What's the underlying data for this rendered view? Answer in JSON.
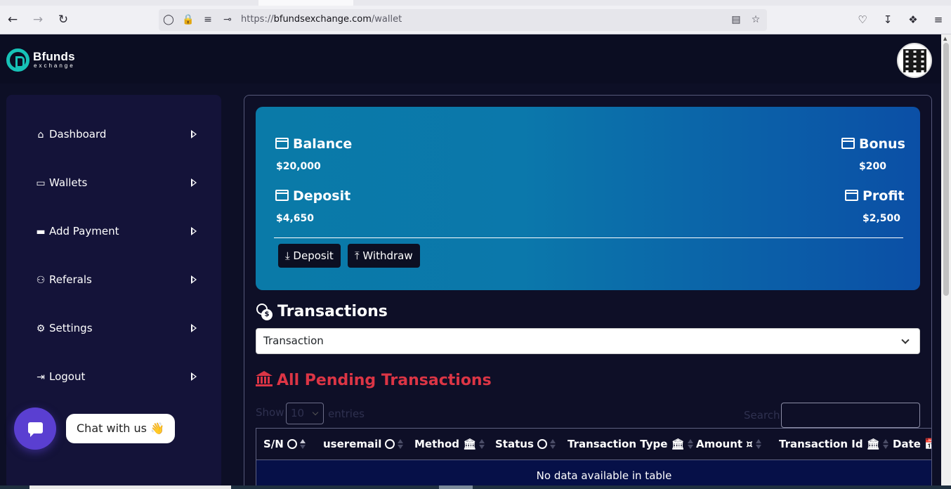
{
  "browser": {
    "url_prefix": "https://",
    "url_host": "bfundsexchange.com",
    "url_path": "/wallet",
    "icons": [
      "back-icon",
      "forward-icon",
      "reload-icon",
      "shield-icon",
      "lock-icon",
      "permissions-icon",
      "key-icon",
      "reader-view-icon",
      "star-icon",
      "pocket-icon",
      "download-icon",
      "extensions-icon",
      "menu-icon"
    ]
  },
  "header": {
    "logo_name": "Bfunds",
    "logo_sub": "exchange",
    "brand_color": "#17c2b7"
  },
  "sidebar": {
    "items": [
      {
        "label": "Dashboard",
        "icon": "home-icon"
      },
      {
        "label": "Wallets",
        "icon": "wallet-icon"
      },
      {
        "label": "Add Payment",
        "icon": "card-icon"
      },
      {
        "label": "Referals",
        "icon": "people-icon"
      },
      {
        "label": "Settings",
        "icon": "user-gear-icon"
      },
      {
        "label": "Logout",
        "icon": "logout-icon"
      }
    ]
  },
  "chat": {
    "label": "Chat with us 👋"
  },
  "wallet": {
    "balance_label": "Balance",
    "balance_value": "$20,000",
    "bonus_label": "Bonus",
    "bonus_value": "$200",
    "deposit_label": "Deposit",
    "deposit_value": "$4,650",
    "profit_label": "Profit",
    "profit_value": "$2,500",
    "deposit_button": "Deposit",
    "withdraw_button": "Withdraw"
  },
  "transactions": {
    "title": "Transactions",
    "select_value": "Transaction",
    "pending_title": "All Pending Transactions",
    "show_label": "Show",
    "show_value": "10",
    "entries_label": "entries",
    "search_label": "Search:",
    "columns": [
      "S/N",
      "useremail",
      "Method",
      "Status",
      "Transaction Type",
      "Amount",
      "Transaction Id",
      "Date"
    ],
    "empty_message": "No data available in table",
    "accent_color": "#dc3545"
  }
}
